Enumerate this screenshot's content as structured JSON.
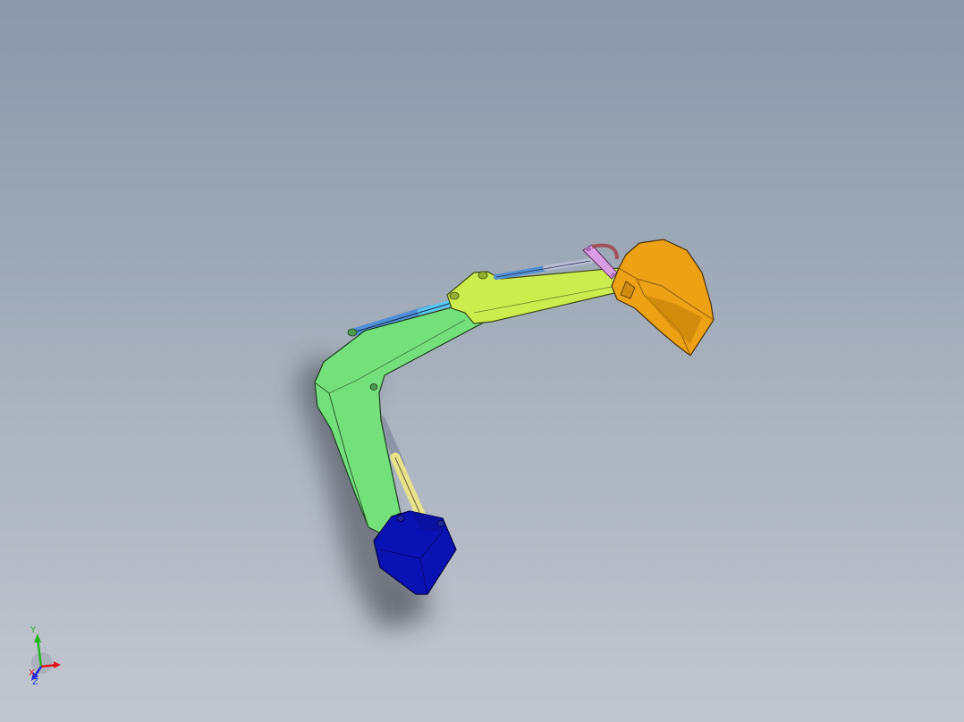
{
  "viewport": {
    "background_top": "#8a98aa",
    "background_bottom": "#c2c6cf"
  },
  "triad": {
    "y_label": "Y",
    "x_label": "X",
    "z_label": "Z",
    "x_color": "#e0141e",
    "y_color": "#1fb51f",
    "z_color": "#1e2de0"
  },
  "parts": {
    "base_color": "#0b12b4",
    "boom_color": "#74e07c",
    "stick_color": "#cdec4e",
    "boom_cylinder_color": "#e8e28a",
    "arm_cylinder_color": "#4f8fd6",
    "bucket_cylinder_color": "#8e9fd4",
    "link_color": "#dc9ce4",
    "bucket_color": "#eda114"
  }
}
